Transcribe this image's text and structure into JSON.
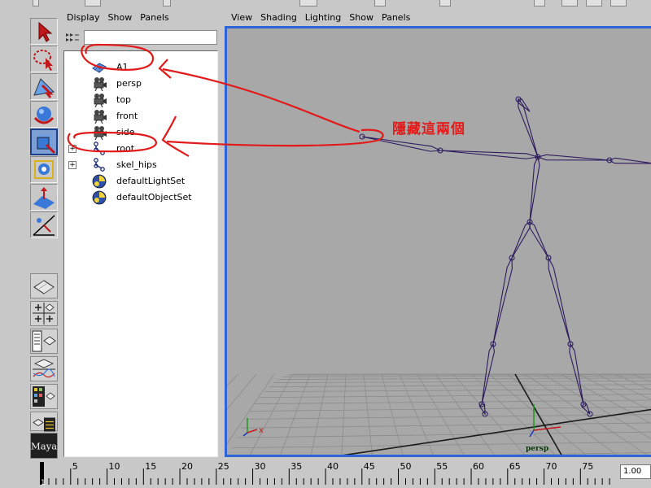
{
  "outliner": {
    "menu": [
      "Display",
      "Show",
      "Panels"
    ],
    "search_value": "",
    "items": [
      {
        "label": "A1",
        "icon": "mesh-icon",
        "expandable": false
      },
      {
        "label": "persp",
        "icon": "camera-icon",
        "expandable": false
      },
      {
        "label": "top",
        "icon": "camera-icon",
        "expandable": false
      },
      {
        "label": "front",
        "icon": "camera-icon",
        "expandable": false
      },
      {
        "label": "side",
        "icon": "camera-icon",
        "expandable": false
      },
      {
        "label": "root",
        "icon": "joint-icon",
        "expandable": true
      },
      {
        "label": "skel_hips",
        "icon": "joint-icon",
        "expandable": true
      },
      {
        "label": "defaultLightSet",
        "icon": "set-icon",
        "expandable": false
      },
      {
        "label": "defaultObjectSet",
        "icon": "set-icon",
        "expandable": false
      }
    ]
  },
  "viewport": {
    "menu": [
      "View",
      "Shading",
      "Lighting",
      "Show",
      "Panels"
    ],
    "camera_label": "persp",
    "axis_label": "x",
    "background": "#a8a8a8",
    "border_color": "#2f63d8",
    "skeleton_color": "#2e1a5e"
  },
  "toolbox": {
    "tools": [
      "select-tool-icon",
      "lasso-tool-icon",
      "move-tool-icon",
      "rotate-tool-icon",
      "scale-tool-icon",
      "universal-manipulator-icon",
      "soft-modify-icon",
      "show-manipulator-icon"
    ],
    "active_tool": "scale-tool-icon",
    "layouts": [
      "single-pane-layout-icon",
      "four-pane-layout-icon",
      "outliner-persp-layout-icon",
      "graph-persp-layout-icon",
      "hypershade-layout-icon",
      "outliner-layout-icon"
    ],
    "logo_text": "Maya"
  },
  "timeline": {
    "ticks": [
      "5",
      "10",
      "15",
      "20",
      "25",
      "30",
      "35",
      "40",
      "45",
      "50",
      "55",
      "60",
      "65",
      "70",
      "75"
    ],
    "current_frame": "1",
    "current_time_value": "1.00"
  },
  "annotation": {
    "text": "隱藏這兩個",
    "color": "#e21a1a"
  }
}
